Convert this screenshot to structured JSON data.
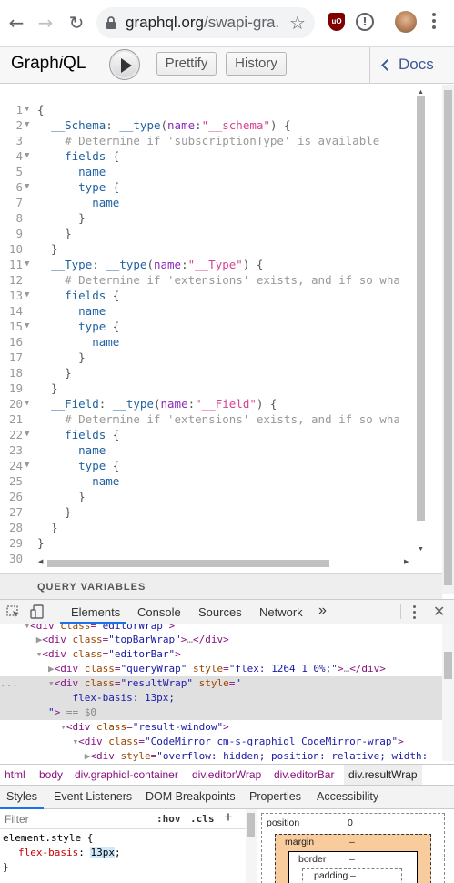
{
  "browser": {
    "url_host": "graphql.org",
    "url_path": "/swapi-gra..."
  },
  "graphiql": {
    "logo_pre": "Graph",
    "logo_i": "i",
    "logo_post": "QL",
    "prettify_label": "Prettify",
    "history_label": "History",
    "docs_label": "Docs",
    "query_variables_label": "QUERY VARIABLES"
  },
  "editor": {
    "lines": [
      {
        "n": "1",
        "fold": true,
        "tokens": [
          [
            "punc",
            "{"
          ]
        ]
      },
      {
        "n": "2",
        "fold": true,
        "tokens": [
          [
            "punc",
            "  "
          ],
          [
            "def",
            "__Schema"
          ],
          [
            "punc",
            ": "
          ],
          [
            "def",
            "__type"
          ],
          [
            "punc",
            "("
          ],
          [
            "attr",
            "name"
          ],
          [
            "punc",
            ":"
          ],
          [
            "str",
            "\"__schema\""
          ],
          [
            "punc",
            ") {"
          ]
        ]
      },
      {
        "n": "3",
        "fold": false,
        "tokens": [
          [
            "punc",
            "    "
          ],
          [
            "com",
            "# Determine if 'subscriptionType' is available"
          ]
        ]
      },
      {
        "n": "4",
        "fold": true,
        "tokens": [
          [
            "punc",
            "    "
          ],
          [
            "prop",
            "fields"
          ],
          [
            "punc",
            " {"
          ]
        ]
      },
      {
        "n": "5",
        "fold": false,
        "tokens": [
          [
            "punc",
            "      "
          ],
          [
            "prop",
            "name"
          ]
        ]
      },
      {
        "n": "6",
        "fold": true,
        "tokens": [
          [
            "punc",
            "      "
          ],
          [
            "prop",
            "type"
          ],
          [
            "punc",
            " {"
          ]
        ]
      },
      {
        "n": "7",
        "fold": false,
        "tokens": [
          [
            "punc",
            "        "
          ],
          [
            "prop",
            "name"
          ]
        ]
      },
      {
        "n": "8",
        "fold": false,
        "tokens": [
          [
            "punc",
            "      }"
          ]
        ]
      },
      {
        "n": "9",
        "fold": false,
        "tokens": [
          [
            "punc",
            "    }"
          ]
        ]
      },
      {
        "n": "10",
        "fold": false,
        "tokens": [
          [
            "punc",
            "  }"
          ]
        ]
      },
      {
        "n": "11",
        "fold": true,
        "tokens": [
          [
            "punc",
            "  "
          ],
          [
            "def",
            "__Type"
          ],
          [
            "punc",
            ": "
          ],
          [
            "def",
            "__type"
          ],
          [
            "punc",
            "("
          ],
          [
            "attr",
            "name"
          ],
          [
            "punc",
            ":"
          ],
          [
            "str",
            "\"__Type\""
          ],
          [
            "punc",
            ") {"
          ]
        ]
      },
      {
        "n": "12",
        "fold": false,
        "tokens": [
          [
            "punc",
            "    "
          ],
          [
            "com",
            "# Determine if 'extensions' exists, and if so wha"
          ]
        ]
      },
      {
        "n": "13",
        "fold": true,
        "tokens": [
          [
            "punc",
            "    "
          ],
          [
            "prop",
            "fields"
          ],
          [
            "punc",
            " {"
          ]
        ]
      },
      {
        "n": "14",
        "fold": false,
        "tokens": [
          [
            "punc",
            "      "
          ],
          [
            "prop",
            "name"
          ]
        ]
      },
      {
        "n": "15",
        "fold": true,
        "tokens": [
          [
            "punc",
            "      "
          ],
          [
            "prop",
            "type"
          ],
          [
            "punc",
            " {"
          ]
        ]
      },
      {
        "n": "16",
        "fold": false,
        "tokens": [
          [
            "punc",
            "        "
          ],
          [
            "prop",
            "name"
          ]
        ]
      },
      {
        "n": "17",
        "fold": false,
        "tokens": [
          [
            "punc",
            "      }"
          ]
        ]
      },
      {
        "n": "18",
        "fold": false,
        "tokens": [
          [
            "punc",
            "    }"
          ]
        ]
      },
      {
        "n": "19",
        "fold": false,
        "tokens": [
          [
            "punc",
            "  }"
          ]
        ]
      },
      {
        "n": "20",
        "fold": true,
        "tokens": [
          [
            "punc",
            "  "
          ],
          [
            "def",
            "__Field"
          ],
          [
            "punc",
            ": "
          ],
          [
            "def",
            "__type"
          ],
          [
            "punc",
            "("
          ],
          [
            "attr",
            "name"
          ],
          [
            "punc",
            ":"
          ],
          [
            "str",
            "\"__Field\""
          ],
          [
            "punc",
            ") {"
          ]
        ]
      },
      {
        "n": "21",
        "fold": false,
        "tokens": [
          [
            "punc",
            "    "
          ],
          [
            "com",
            "# Determine if 'extensions' exists, and if so wha"
          ]
        ]
      },
      {
        "n": "22",
        "fold": true,
        "tokens": [
          [
            "punc",
            "    "
          ],
          [
            "prop",
            "fields"
          ],
          [
            "punc",
            " {"
          ]
        ]
      },
      {
        "n": "23",
        "fold": false,
        "tokens": [
          [
            "punc",
            "      "
          ],
          [
            "prop",
            "name"
          ]
        ]
      },
      {
        "n": "24",
        "fold": true,
        "tokens": [
          [
            "punc",
            "      "
          ],
          [
            "prop",
            "type"
          ],
          [
            "punc",
            " {"
          ]
        ]
      },
      {
        "n": "25",
        "fold": false,
        "tokens": [
          [
            "punc",
            "        "
          ],
          [
            "prop",
            "name"
          ]
        ]
      },
      {
        "n": "26",
        "fold": false,
        "tokens": [
          [
            "punc",
            "      }"
          ]
        ]
      },
      {
        "n": "27",
        "fold": false,
        "tokens": [
          [
            "punc",
            "    }"
          ]
        ]
      },
      {
        "n": "28",
        "fold": false,
        "tokens": [
          [
            "punc",
            "  }"
          ]
        ]
      },
      {
        "n": "29",
        "fold": false,
        "tokens": [
          [
            "punc",
            "}"
          ]
        ]
      },
      {
        "n": "30",
        "fold": false,
        "tokens": []
      }
    ]
  },
  "devtools": {
    "tabs": [
      "Elements",
      "Console",
      "Sources",
      "Network"
    ],
    "more_tabs": "»",
    "dom_lines": [
      [
        [
          "dots",
          "    ▾"
        ],
        [
          "tag",
          "<div "
        ],
        [
          "attn",
          "class"
        ],
        [
          "tag",
          "="
        ],
        [
          "attv",
          "\"editorWrap\""
        ],
        [
          "tag",
          ">"
        ]
      ],
      [
        [
          "dots",
          "      ▶"
        ],
        [
          "tag",
          "<div "
        ],
        [
          "attn",
          "class"
        ],
        [
          "tag",
          "="
        ],
        [
          "attv",
          "\"topBarWrap\""
        ],
        [
          "tag",
          ">"
        ],
        [
          "dots",
          "…"
        ],
        [
          "tag",
          "</div>"
        ]
      ],
      [
        [
          "dots",
          "      ▾"
        ],
        [
          "tag",
          "<div "
        ],
        [
          "attn",
          "class"
        ],
        [
          "tag",
          "="
        ],
        [
          "attv",
          "\"editorBar\""
        ],
        [
          "tag",
          ">"
        ]
      ],
      [
        [
          "dots",
          "        ▶"
        ],
        [
          "tag",
          "<div "
        ],
        [
          "attn",
          "class"
        ],
        [
          "tag",
          "="
        ],
        [
          "attv",
          "\"queryWrap\""
        ],
        [
          "tag",
          " "
        ],
        [
          "attn",
          "style"
        ],
        [
          "tag",
          "="
        ],
        [
          "attv",
          "\"flex: 1264 1 0%;\""
        ],
        [
          "tag",
          ">"
        ],
        [
          "dots",
          "…"
        ],
        [
          "tag",
          "</div>"
        ]
      ],
      [
        [
          "dots",
          "...     ▾"
        ],
        [
          "tag",
          "<div "
        ],
        [
          "attn",
          "class"
        ],
        [
          "tag",
          "="
        ],
        [
          "attv",
          "\"resultWrap\""
        ],
        [
          "tag",
          " "
        ],
        [
          "attn",
          "style"
        ],
        [
          "tag",
          "="
        ],
        [
          "attv",
          "\""
        ]
      ],
      [
        [
          "attv",
          "            flex-basis: 13px;"
        ]
      ],
      [
        [
          "attv",
          "        \""
        ],
        [
          "tag",
          ">"
        ],
        [
          "eq",
          " == $0"
        ]
      ],
      [
        [
          "dots",
          "          ▾"
        ],
        [
          "tag",
          "<div "
        ],
        [
          "attn",
          "class"
        ],
        [
          "tag",
          "="
        ],
        [
          "attv",
          "\"result-window\""
        ],
        [
          "tag",
          ">"
        ]
      ],
      [
        [
          "dots",
          "            ▾"
        ],
        [
          "tag",
          "<div "
        ],
        [
          "attn",
          "class"
        ],
        [
          "tag",
          "="
        ],
        [
          "attv",
          "\"CodeMirror cm-s-graphiql CodeMirror-wrap\""
        ],
        [
          "tag",
          ">"
        ]
      ],
      [
        [
          "dots",
          "              ▶"
        ],
        [
          "tag",
          "<div "
        ],
        [
          "attn",
          "style"
        ],
        [
          "tag",
          "="
        ],
        [
          "attv",
          "\"overflow: hidden; position: relative; width:"
        ]
      ]
    ],
    "breadcrumbs": [
      "html",
      "body",
      "div.graphiql-container",
      "div.editorWrap",
      "div.editorBar",
      "div.resultWrap"
    ],
    "sub_tabs": [
      "Styles",
      "Event Listeners",
      "DOM Breakpoints",
      "Properties",
      "Accessibility"
    ],
    "filter_placeholder": "Filter",
    "hov_label": ":hov",
    "cls_label": ".cls",
    "plus_label": "+",
    "rule_selector": "element.style {",
    "rule_prop": "flex-basis",
    "rule_value": "13px",
    "rule_close": "}",
    "box_model": {
      "position_label": "position",
      "position_value": "0",
      "margin_label": "margin",
      "margin_value": "–",
      "border_label": "border",
      "border_value": "–",
      "padding_label": "padding",
      "padding_value": "–"
    }
  }
}
